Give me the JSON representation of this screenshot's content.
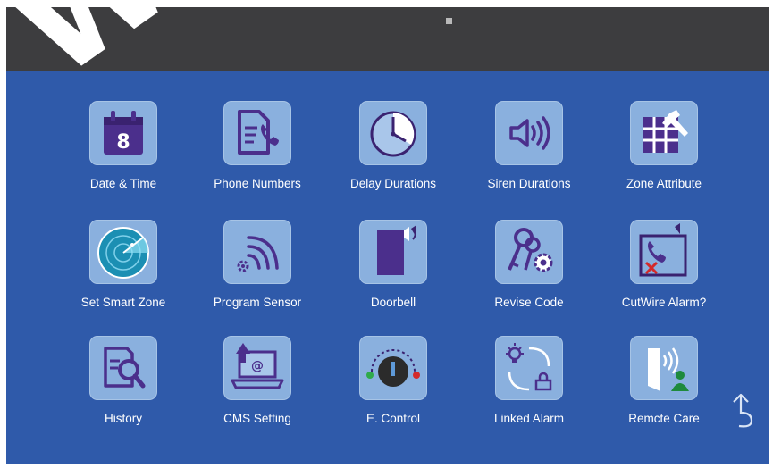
{
  "watermark": "WWW.",
  "menu": {
    "date_time": "Date & Time",
    "calendar_day": "8",
    "phone_numbers": "Phone Numbers",
    "delay_durations": "Delay Durations",
    "siren_durations": "Siren Durations",
    "zone_attribute": "Zone Attribute",
    "set_smart_zone": "Set Smart Zone",
    "program_sensor": "Program Sensor",
    "doorbell": "Doorbell",
    "revise_code": "Revise Code",
    "cutwire_alarm": "CutWire Alarm?",
    "history": "History",
    "cms_setting": "CMS Setting",
    "cms_symbol": "@",
    "e_control": "E. Control",
    "linked_alarm": "Linked Alarm",
    "remote_care": "Remcte Care"
  },
  "colors": {
    "screen": "#2f5aaa",
    "top_bar": "#3d3d3f",
    "icon_bg": "#8ab0de",
    "icon_fg": "#4b2f8c"
  }
}
